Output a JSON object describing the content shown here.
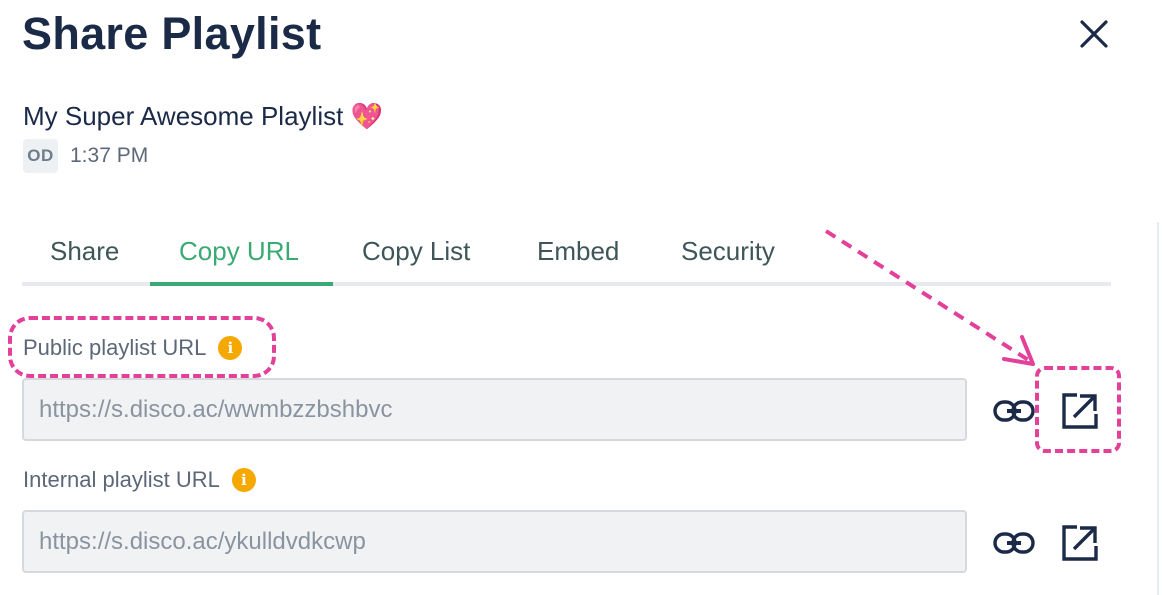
{
  "dialog": {
    "title": "Share Playlist",
    "close_icon": "close-icon"
  },
  "playlist": {
    "name": "My Super Awesome Playlist 💖",
    "avatar_initials": "OD",
    "timestamp": "1:37 PM"
  },
  "tabs": [
    {
      "label": "Share",
      "active": false
    },
    {
      "label": "Copy URL",
      "active": true
    },
    {
      "label": "Copy List",
      "active": false
    },
    {
      "label": "Embed",
      "active": false
    },
    {
      "label": "Security",
      "active": false
    }
  ],
  "fields": {
    "public": {
      "label": "Public playlist URL",
      "info_symbol": "i",
      "value": "https://s.disco.ac/wwmbzzbshbvc"
    },
    "internal": {
      "label": "Internal playlist URL",
      "info_symbol": "i",
      "value": "https://s.disco.ac/ykulldvdkcwp"
    }
  },
  "icons": [
    "close-icon",
    "info-icon",
    "link-icon",
    "open-external-icon"
  ],
  "colors": {
    "title": "#1b2a47",
    "accent_active_tab": "#3aaa74",
    "info_badge": "#f5a800",
    "annotation": "#e3409a"
  }
}
